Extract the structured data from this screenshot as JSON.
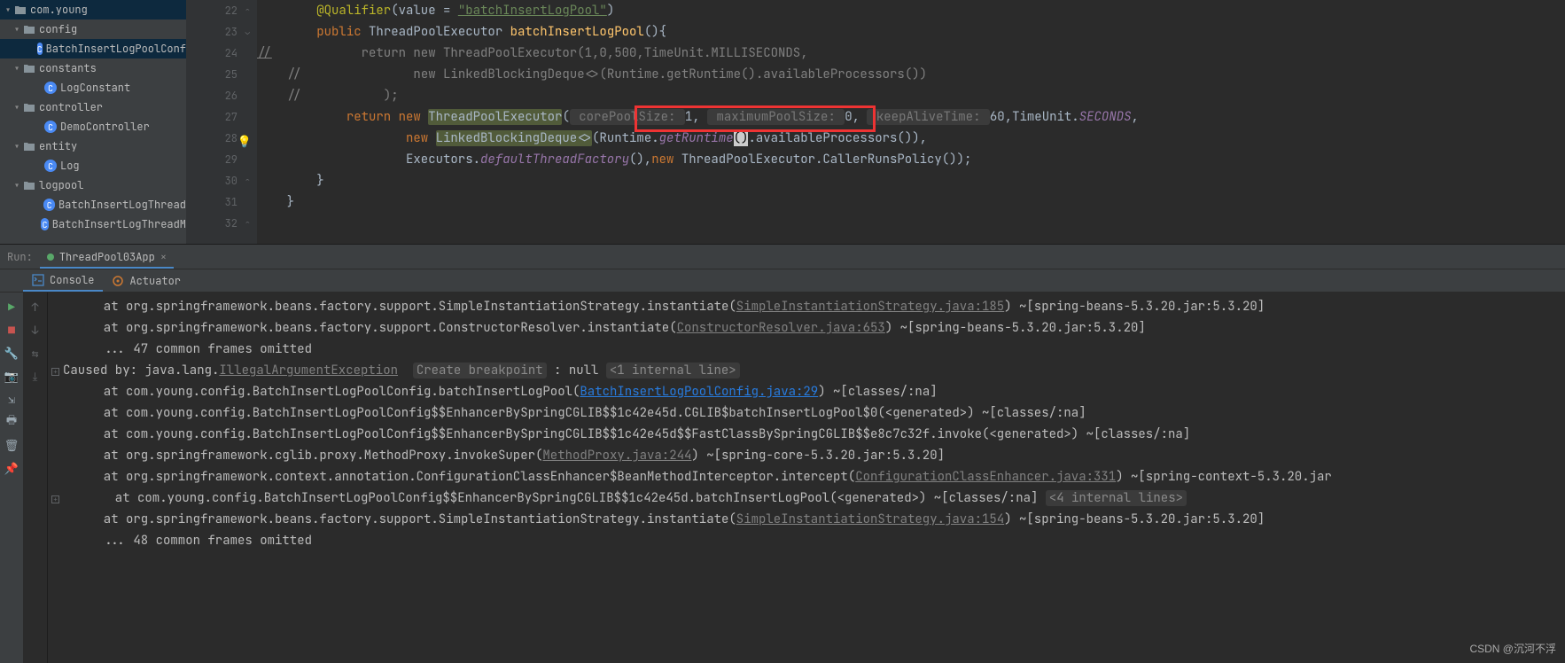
{
  "tree": {
    "items": [
      {
        "indent": 4,
        "tw": "▾",
        "icon": "folder",
        "label": "com.young"
      },
      {
        "indent": 14,
        "tw": "▾",
        "icon": "folder",
        "label": "config"
      },
      {
        "indent": 38,
        "tw": "",
        "icon": "cls",
        "label": "BatchInsertLogPoolConf",
        "sel": true
      },
      {
        "indent": 14,
        "tw": "▾",
        "icon": "folder",
        "label": "constants"
      },
      {
        "indent": 38,
        "tw": "",
        "icon": "cls",
        "label": "LogConstant"
      },
      {
        "indent": 14,
        "tw": "▾",
        "icon": "folder",
        "label": "controller"
      },
      {
        "indent": 38,
        "tw": "",
        "icon": "cls",
        "label": "DemoController"
      },
      {
        "indent": 14,
        "tw": "▾",
        "icon": "folder",
        "label": "entity"
      },
      {
        "indent": 38,
        "tw": "",
        "icon": "cls",
        "label": "Log"
      },
      {
        "indent": 14,
        "tw": "▾",
        "icon": "folder",
        "label": "logpool"
      },
      {
        "indent": 38,
        "tw": "",
        "icon": "cls",
        "label": "BatchInsertLogThread"
      },
      {
        "indent": 38,
        "tw": "",
        "icon": "cls",
        "label": "BatchInsertLogThreadM"
      }
    ]
  },
  "code": {
    "lines": [
      "22",
      "23",
      "24",
      "25",
      "26",
      "27",
      "28",
      "29",
      "30",
      "31",
      "32"
    ],
    "l22_ann": "@Qualifier",
    "l22_val": "(value = ",
    "l22_str": "\"batchInsertLogPool\"",
    "l22_end": ")",
    "l23_pub": "public ",
    "l23_type": "ThreadPoolExecutor ",
    "l23_fn": "batchInsertLogPool",
    "l23_end": "(){",
    "l24_pre": "       return new ThreadPoolExecutor(1,0,500,TimeUnit.MILLISECONDS,",
    "l25": "           new LinkedBlockingDeque<>(Runtime.getRuntime().availableProcessors())",
    "l26": "       );",
    "l27_ret": "return ",
    "l27_new": "new ",
    "l27_cls": "ThreadPoolExecutor",
    "l27_op": "(",
    "l27_h1": " corePoolSize: ",
    "l27_v1": "1",
    "l27_c1": ", ",
    "l27_h2": " maximumPoolSize: ",
    "l27_v2": "0",
    "l27_c2": ", ",
    "l27_h3": " keepAliveTime: ",
    "l27_v3": "60",
    "l27_c3": ",",
    "l27_tu": "TimeUnit.",
    "l27_sec": "SECONDS",
    "l27_end": ",",
    "l28_new": "new ",
    "l28_cls": "LinkedBlockingDeque<>",
    "l28_a": "(Runtime.",
    "l28_get": "getRuntime",
    "l28_b": "()",
    "l28_c": ".availableProcessors()),",
    "l29_a": "Executors.",
    "l29_f": "defaultThreadFactory",
    "l29_b": "(),",
    "l29_new": "new ",
    "l29_c": "ThreadPoolExecutor.CallerRunsPolicy());",
    "l30": "}",
    "l31": "}"
  },
  "run": {
    "label": "Run:",
    "tab": "ThreadPool03App",
    "consoleTab": "Console",
    "actuatorTab": "Actuator"
  },
  "console": {
    "rows": [
      {
        "pre": "       at org.springframework.beans.factory.support.SimpleInstantiationStrategy.instantiate(",
        "link": "SimpleInstantiationStrategy.java:185",
        "ltype": "grey",
        "post": ") ~[spring-beans-5.3.20.jar:5.3.20]"
      },
      {
        "pre": "       at org.springframework.beans.factory.support.ConstructorResolver.instantiate(",
        "link": "ConstructorResolver.java:653",
        "ltype": "grey",
        "post": ") ~[spring-beans-5.3.20.jar:5.3.20]"
      },
      {
        "pre": "       ... 47 common frames omitted",
        "link": "",
        "ltype": "",
        "post": ""
      }
    ],
    "caused": "Caused by: java.lang.",
    "exc": "IllegalArgumentException",
    "bp": "Create breakpoint",
    "nul": " : null ",
    "internal": "<1 internal line>",
    "rows2": [
      {
        "pre": "       at com.young.config.BatchInsertLogPoolConfig.batchInsertLogPool(",
        "link": "BatchInsertLogPoolConfig.java:29",
        "ltype": "blue",
        "post": ") ~[classes/:na]"
      },
      {
        "pre": "       at com.young.config.BatchInsertLogPoolConfig$$EnhancerBySpringCGLIB$$1c42e45d.CGLIB$batchInsertLogPool$0(<generated>) ~[classes/:na]",
        "link": "",
        "ltype": "",
        "post": ""
      },
      {
        "pre": "       at com.young.config.BatchInsertLogPoolConfig$$EnhancerBySpringCGLIB$$1c42e45d$$FastClassBySpringCGLIB$$e8c7c32f.invoke(<generated>) ~[classes/:na]",
        "link": "",
        "ltype": "",
        "post": ""
      },
      {
        "pre": "       at org.springframework.cglib.proxy.MethodProxy.invokeSuper(",
        "link": "MethodProxy.java:244",
        "ltype": "grey",
        "post": ") ~[spring-core-5.3.20.jar:5.3.20]"
      },
      {
        "pre": "       at org.springframework.context.annotation.ConfigurationClassEnhancer$BeanMethodInterceptor.intercept(",
        "link": "ConfigurationClassEnhancer.java:331",
        "ltype": "grey",
        "post": ") ~[spring-context-5.3.20.jar"
      },
      {
        "pre": "       at com.young.config.BatchInsertLogPoolConfig$$EnhancerBySpringCGLIB$$1c42e45d.batchInsertLogPool(<generated>) ~[classes/:na] ",
        "link": "",
        "ltype": "",
        "post": "",
        "hint": "<4 internal lines>"
      },
      {
        "pre": "       at org.springframework.beans.factory.support.SimpleInstantiationStrategy.instantiate(",
        "link": "SimpleInstantiationStrategy.java:154",
        "ltype": "grey",
        "post": ") ~[spring-beans-5.3.20.jar:5.3.20]"
      },
      {
        "pre": "       ... 48 common frames omitted",
        "link": "",
        "ltype": "",
        "post": ""
      }
    ]
  },
  "watermark": "CSDN @沉河不浮"
}
